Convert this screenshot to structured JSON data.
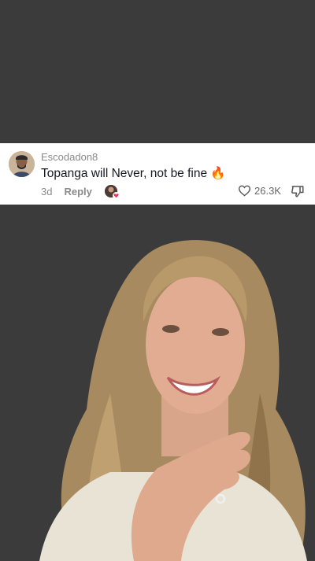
{
  "comment": {
    "username": "Escodadon8",
    "text": "Topanga will Never, not be fine",
    "emoji": "🔥",
    "age": "3d",
    "reply_label": "Reply",
    "like_count": "26.3K",
    "icons": [
      "user-avatar",
      "liked-by-creator-avatar",
      "heart-icon",
      "dislike-icon",
      "fire-emoji"
    ]
  },
  "colors": {
    "video_background": "#3b3b3b",
    "card_background": "#ffffff",
    "comment_text": "#161823",
    "muted_text": "#8a8a8a",
    "creator_heart": "#fe2c55"
  }
}
